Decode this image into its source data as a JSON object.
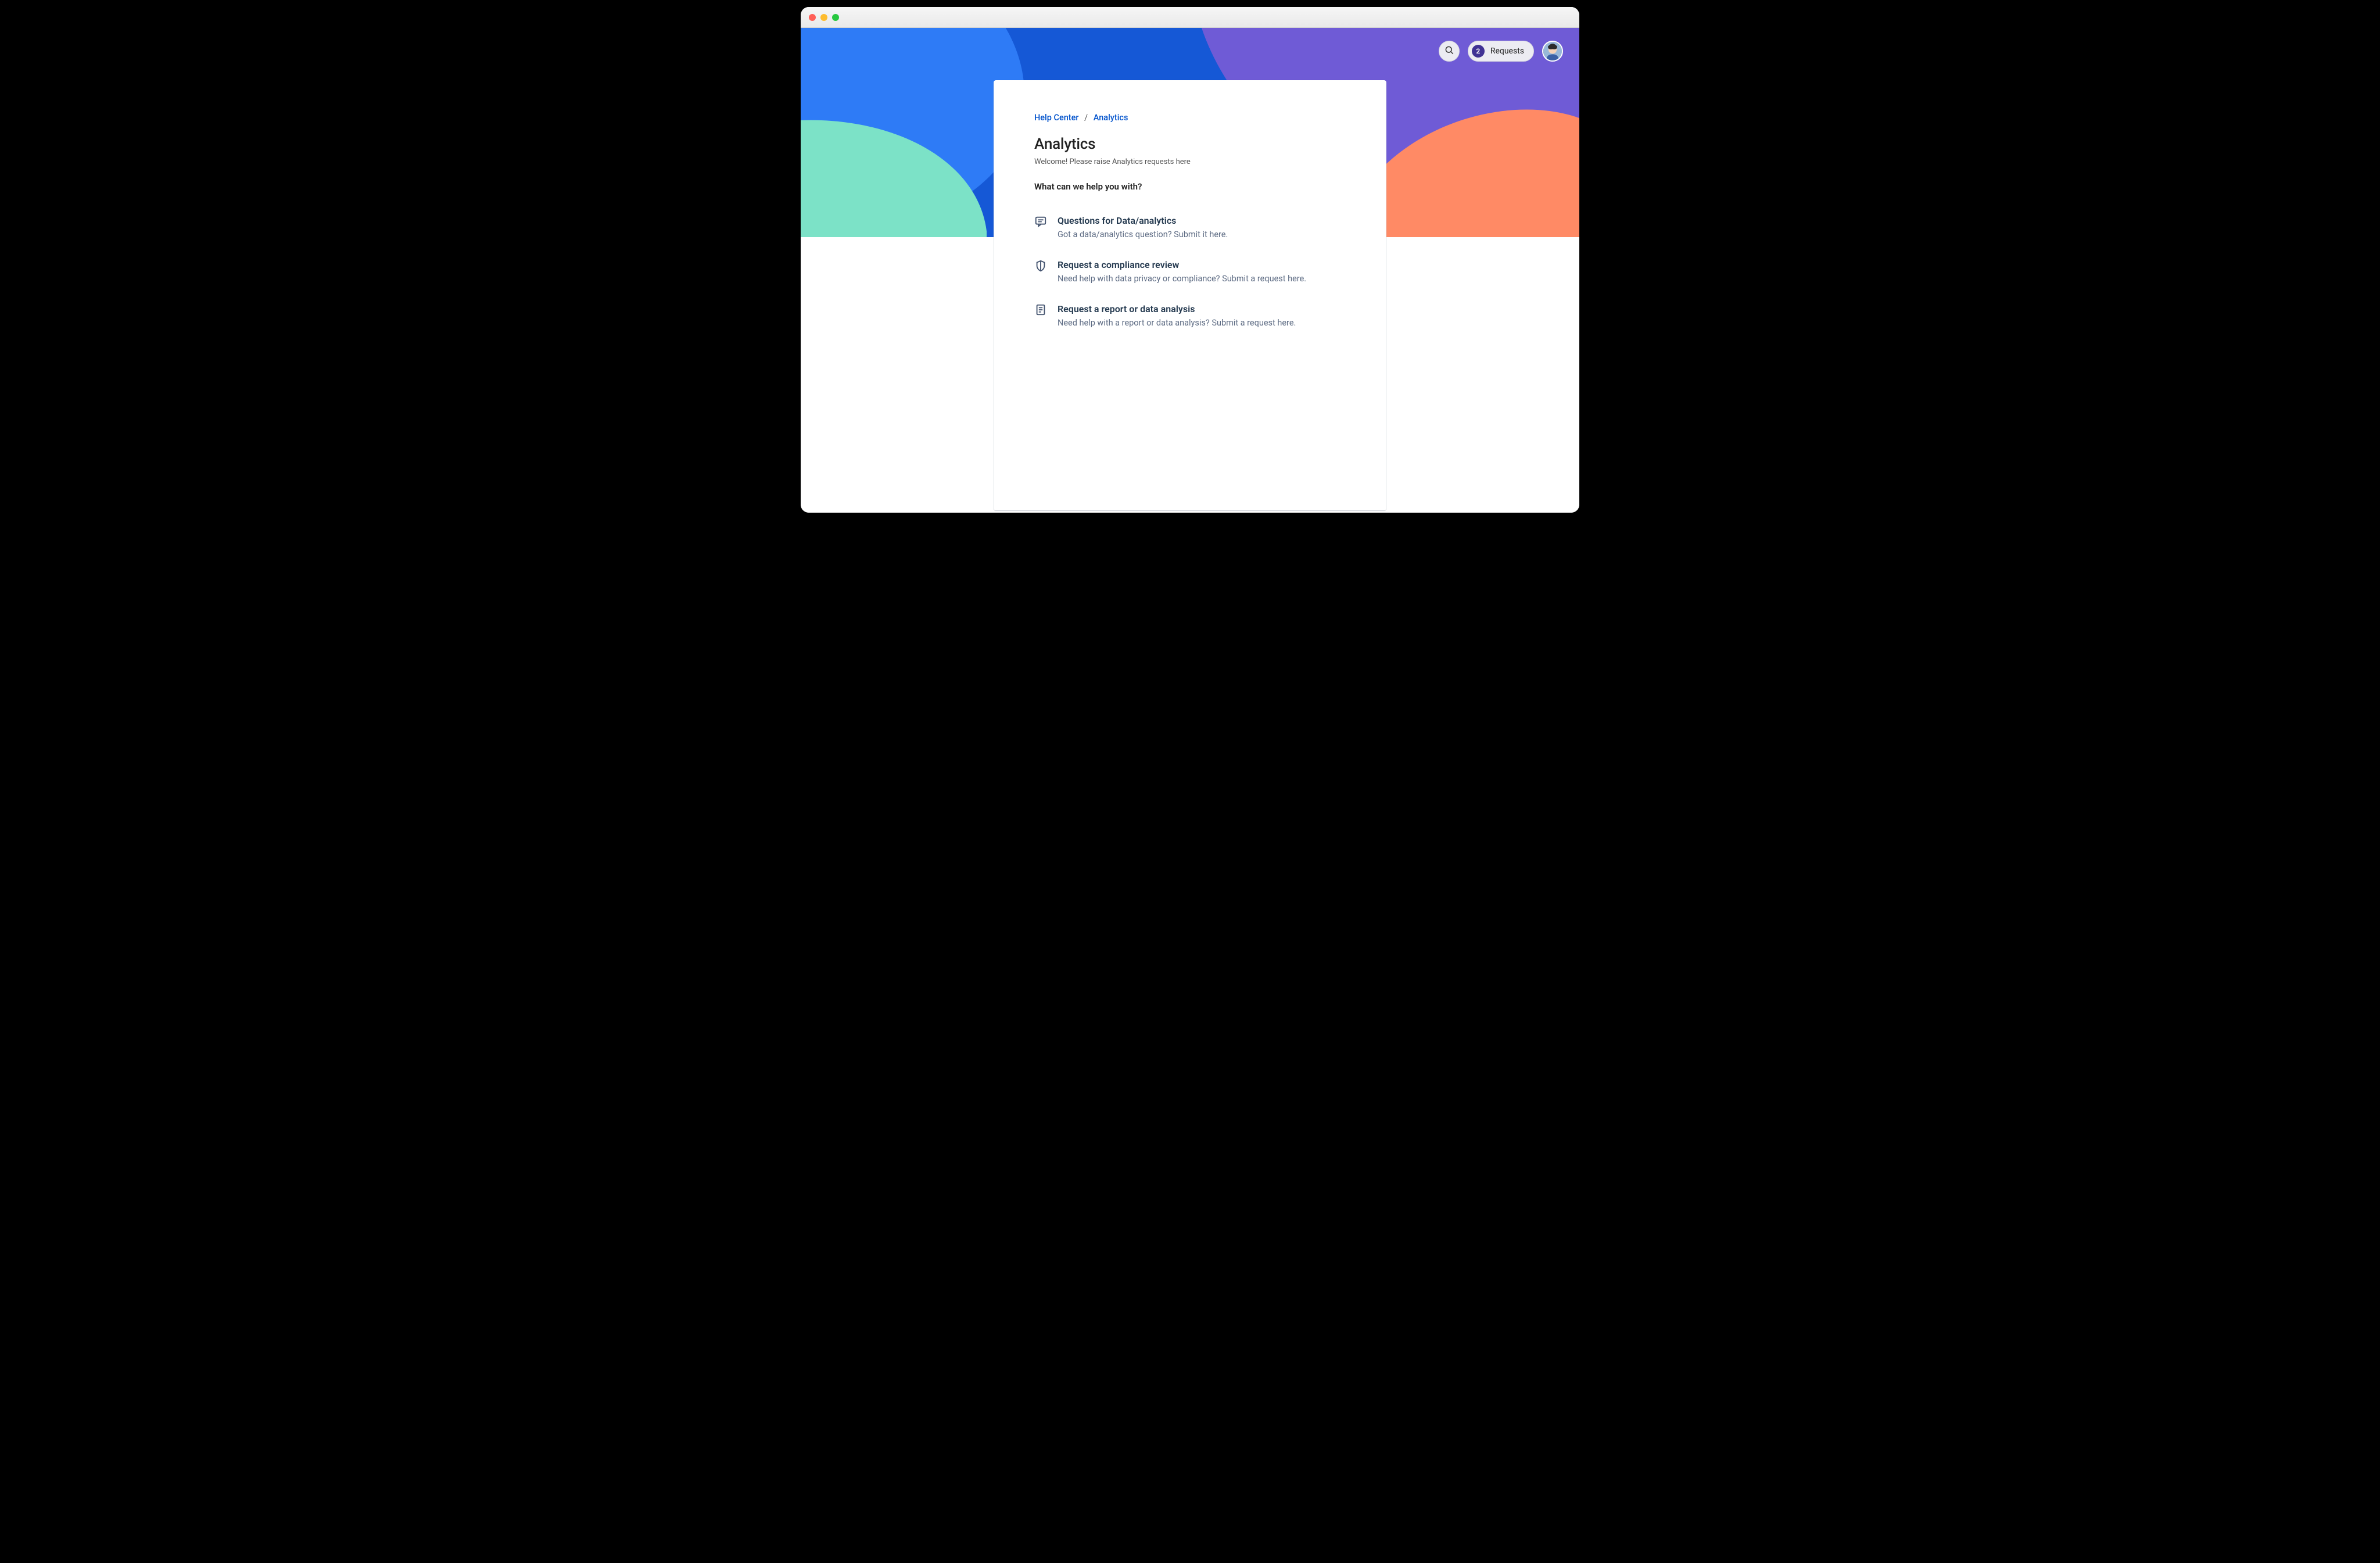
{
  "topbar": {
    "requests_count": "2",
    "requests_label": "Requests"
  },
  "breadcrumb": {
    "root": "Help Center",
    "current": "Analytics"
  },
  "page": {
    "title": "Analytics",
    "subtitle": "Welcome! Please raise Analytics requests here",
    "help_heading": "What can we help you with?"
  },
  "requests": [
    {
      "icon": "chat",
      "title": "Questions for Data/analytics",
      "desc": "Got a data/analytics question? Submit it here."
    },
    {
      "icon": "shield",
      "title": "Request a compliance review",
      "desc": "Need help with data privacy or compliance? Submit a request here."
    },
    {
      "icon": "report",
      "title": "Request a report or data analysis",
      "desc": "Need help with a report or data analysis? Submit a request here."
    }
  ]
}
